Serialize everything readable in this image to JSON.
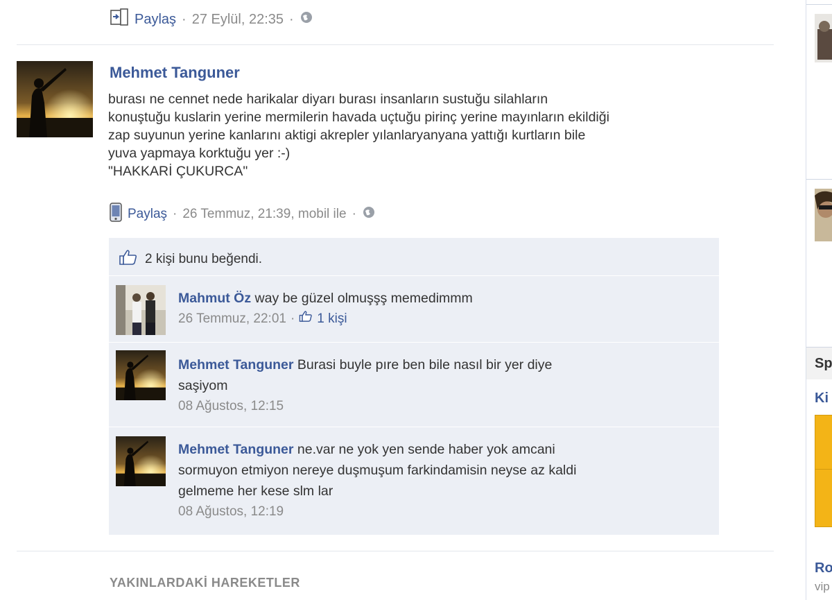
{
  "prev_story": {
    "share_label": "Paylaş",
    "dot": "·",
    "timestamp": "27 Eylül, 22:35"
  },
  "story": {
    "author": "Mehmet Tanguner",
    "text_lines": [
      "burası ne cennet nede harikalar diyarı burası insanların sustuğu silahların",
      "konuştuğu kuslarin yerine mermilerin havada uçtuğu pirinç yerine mayınların ekildiği",
      "zap suyunun yerine kanlarını aktigi akrepler yılanlaryanyana yattığı kurtların bile",
      "yuva yapmaya korktuğu yer :-)",
      "\"HAKKARİ ÇUKURCA\""
    ],
    "share_label": "Paylaş",
    "dot": "·",
    "timestamp": "26 Temmuz, 21:39, mobil ile"
  },
  "likes": {
    "text": "2 kişi bunu beğendi."
  },
  "comments": [
    {
      "author": "Mahmut Öz",
      "lines": [
        "way be güzel olmuşşş memedimmm"
      ],
      "time": "26 Temmuz, 22:01",
      "dot": "·",
      "like_count": "1 kişi"
    },
    {
      "author": "Mehmet Tanguner",
      "lines": [
        "Burasi buyle pıre ben bile nasıl bir yer diye",
        "saşiyom"
      ],
      "time": "08 Ağustos, 12:15"
    },
    {
      "author": "Mehmet Tanguner",
      "lines": [
        "ne.var ne yok yen sende haber yok amcani",
        "sormuyon etmiyon nereye duşmuşum farkindamisin neyse az kaldi",
        "gelmeme her kese slm lar"
      ],
      "time": "08 Ağustos, 12:19"
    }
  ],
  "recent_activity_title": "YAKINLARDAKİ HAREKETLER",
  "right_column": {
    "header_fragment": "Sp",
    "link_fragment": "Ki",
    "link_fragment2": "Ro",
    "text_fragment": "vip"
  },
  "colors": {
    "link": "#3b5998",
    "muted": "#8a8a8a",
    "comment_bg": "#eceff5"
  }
}
